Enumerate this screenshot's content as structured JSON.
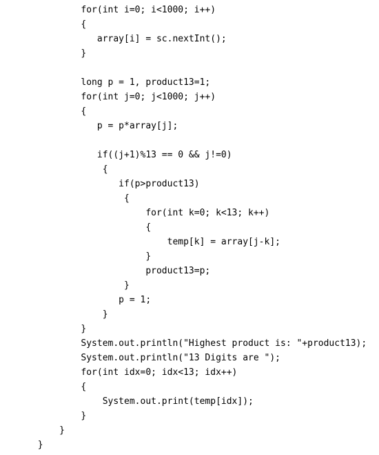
{
  "code": {
    "indent": "               ",
    "lines": [
      "for(int i=0; i<1000; i++)",
      "{",
      "   array[i] = sc.nextInt();",
      "}",
      "",
      "long p = 1, product13=1;",
      "for(int j=0; j<1000; j++)",
      "{",
      "   p = p*array[j];",
      "",
      "   if((j+1)%13 == 0 && j!=0)",
      "    {",
      "       if(p>product13)",
      "        {",
      "            for(int k=0; k<13; k++)",
      "            {",
      "                temp[k] = array[j-k];",
      "            }",
      "            product13=p;",
      "        }",
      "       p = 1;",
      "    }",
      "}",
      "System.out.println(\"Highest product is: \"+product13);",
      "System.out.println(\"13 Digits are \");",
      "for(int idx=0; idx<13; idx++)",
      "{",
      "    System.out.print(temp[idx]);",
      "}"
    ],
    "closing": [
      "           }",
      "       }"
    ]
  }
}
